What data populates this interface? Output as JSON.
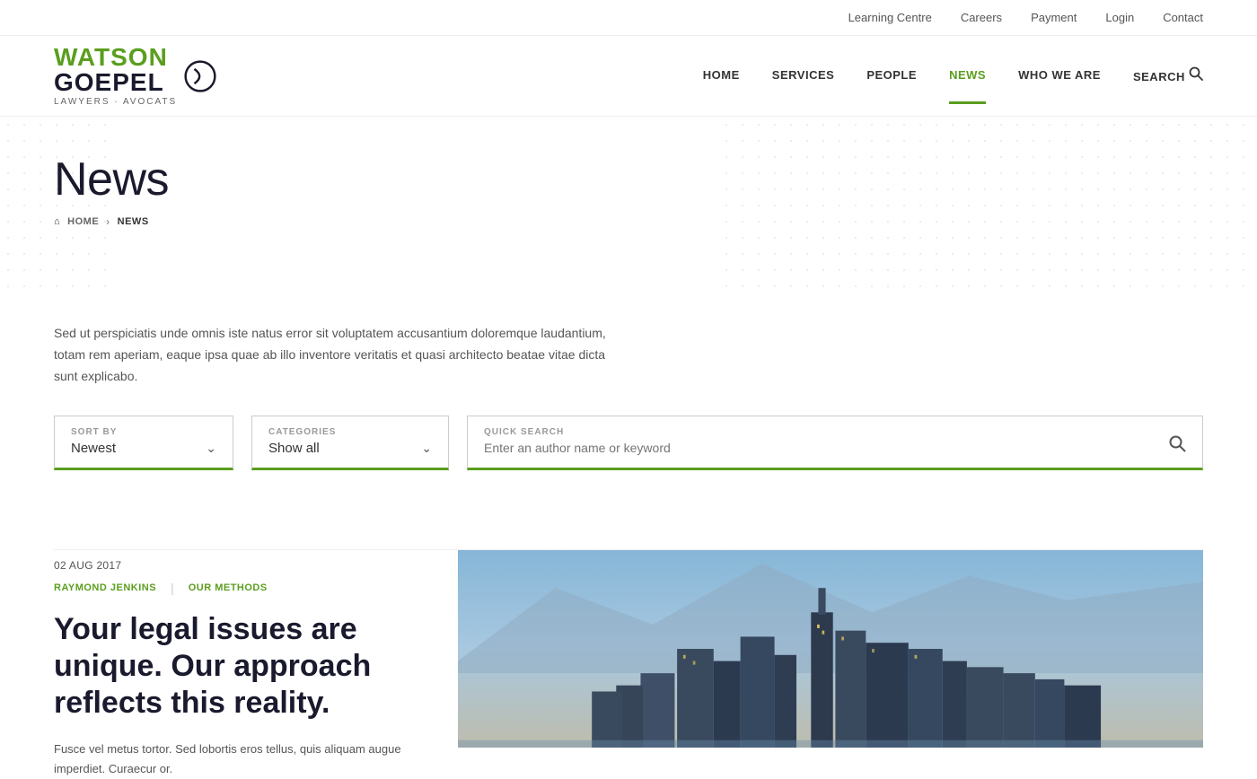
{
  "topBar": {
    "links": [
      {
        "label": "Learning Centre",
        "href": "#"
      },
      {
        "label": "Careers",
        "href": "#"
      },
      {
        "label": "Payment",
        "href": "#"
      },
      {
        "label": "Login",
        "href": "#"
      },
      {
        "label": "Contact",
        "href": "#"
      }
    ]
  },
  "logo": {
    "line1": "WATSON",
    "line2": "GOEPEL",
    "sub": "LAWYERS · AVOCATS"
  },
  "nav": {
    "items": [
      {
        "label": "HOME",
        "href": "#",
        "active": false
      },
      {
        "label": "SERVICES",
        "href": "#",
        "active": false
      },
      {
        "label": "PEOPLE",
        "href": "#",
        "active": false
      },
      {
        "label": "NEWS",
        "href": "#",
        "active": true
      },
      {
        "label": "WHO WE ARE",
        "href": "#",
        "active": false
      }
    ],
    "searchLabel": "SEARCH"
  },
  "hero": {
    "title": "News",
    "breadcrumb": {
      "home": "HOME",
      "current": "NEWS"
    }
  },
  "intro": {
    "text": "Sed ut perspiciatis unde omnis iste natus error sit voluptatem accusantium doloremque laudantium, totam rem aperiam, eaque ipsa quae ab illo inventore veritatis et quasi architecto beatae vitae dicta sunt explicabo."
  },
  "filters": {
    "sortBy": {
      "label": "SORT BY",
      "value": "Newest"
    },
    "categories": {
      "label": "CATEGORIES",
      "value": "Show all"
    },
    "quickSearch": {
      "label": "QUICK SEARCH",
      "placeholder": "Enter an author name or keyword"
    }
  },
  "article": {
    "date": "02 AUG 2017",
    "tags": [
      {
        "label": "RAYMOND JENKINS",
        "href": "#"
      },
      {
        "label": "OUR METHODS",
        "href": "#"
      }
    ],
    "title": "Your legal issues are unique. Our approach reflects this reality.",
    "excerpt": "Fusce vel metus tortor. Sed lobortis eros tellus, quis aliquam augue imperdiet. Curaecur or.",
    "imageAlt": "Vancouver city skyline at sunset"
  },
  "colors": {
    "green": "#5a9e1e",
    "darkNavy": "#1a1a2e"
  }
}
